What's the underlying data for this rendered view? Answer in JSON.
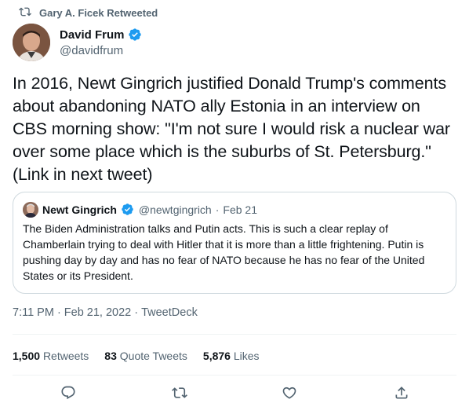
{
  "retweet_header": {
    "text": "Gary A. Ficek Retweeted",
    "icon": "retweet-icon"
  },
  "tweet": {
    "author_name": "David Frum",
    "author_handle": "@davidfrum",
    "text": "In 2016, Newt Gingrich justified Donald Trump's comments about abandoning NATO ally Estonia in an interview on CBS morning show: \"I'm not sure I would risk a nuclear war over some place which is the suburbs of St. Petersburg.\" (Link in next tweet)",
    "time": "7:11 PM",
    "date": "Feb 21, 2022",
    "source": "TweetDeck",
    "sep": "·"
  },
  "quote": {
    "author_name": "Newt Gingrich",
    "author_handle": "@newtgingrich",
    "date": "Feb 21",
    "sep": "·",
    "text": "The Biden Administration talks and Putin acts. This is such a clear replay of Chamberlain trying to deal with Hitler that it is more than a little frightening. Putin is pushing day by day and has no fear of NATO because he has no fear of the United States or its President."
  },
  "stats": {
    "retweets_count": "1,500",
    "retweets_label": "Retweets",
    "quotes_count": "83",
    "quotes_label": "Quote Tweets",
    "likes_count": "5,876",
    "likes_label": "Likes"
  },
  "actions": [
    "reply-icon",
    "retweet-icon",
    "like-icon",
    "share-icon"
  ],
  "colors": {
    "text": "#0f1419",
    "secondary": "#536471",
    "verified": "#1d9bf0",
    "border": "#cfd9de"
  }
}
